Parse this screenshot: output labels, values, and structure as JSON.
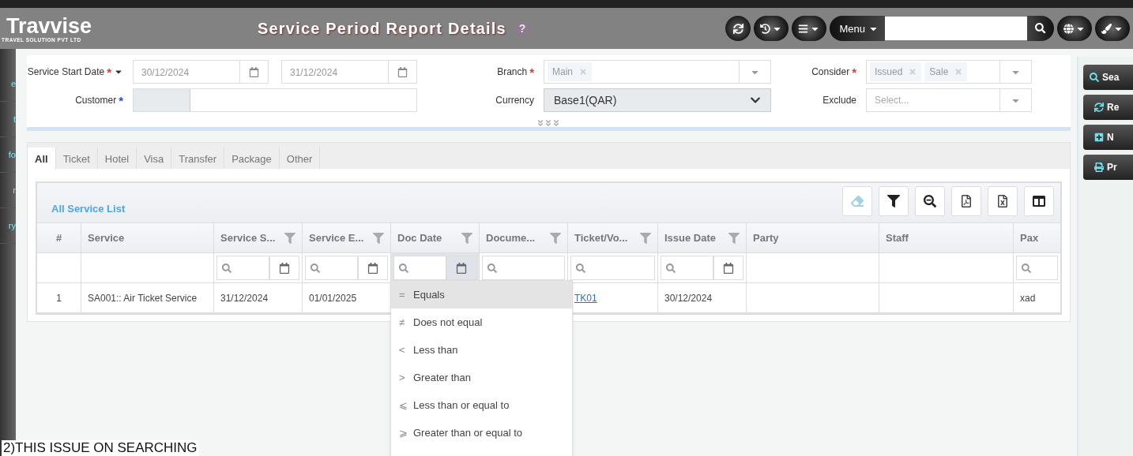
{
  "header": {
    "logo": "Travvise",
    "tagline": "TRAVEL SOLUTION PVT LTD",
    "title": "Service Period Report Details",
    "help": "?",
    "tools": [
      {
        "kind": "refresh",
        "caret": false
      },
      {
        "kind": "history",
        "caret": true
      },
      {
        "kind": "list",
        "caret": true
      }
    ],
    "menu_button": "Menu",
    "end_tools": [
      {
        "kind": "translate",
        "caret": true
      },
      {
        "kind": "brush",
        "caret": true
      }
    ]
  },
  "sidebar": {
    "items": [
      "e",
      "t",
      "fo",
      "r",
      "ry"
    ]
  },
  "filters": {
    "service_date": {
      "label": "Service Start Date",
      "mark": {
        "text": "*",
        "color": "#e53935"
      },
      "from": "30/12/2024",
      "to": "31/12/2024"
    },
    "customer": {
      "label": "Customer",
      "mark": {
        "text": "*",
        "color": "#1e4fd8"
      }
    },
    "branch": {
      "label": "Branch",
      "mark": {
        "text": "*",
        "color": "#e53935"
      },
      "tags": [
        "Main"
      ]
    },
    "currency": {
      "label": "Currency",
      "value": "Base1(QAR)"
    },
    "consider": {
      "label": "Consider",
      "mark": {
        "text": "*",
        "color": "#e53935"
      },
      "tags": [
        "Issued",
        "Sale"
      ]
    },
    "exclude": {
      "label": "Exclude",
      "placeholder": "Select..."
    }
  },
  "side_buttons": [
    {
      "kind": "search",
      "label": "Sea"
    },
    {
      "kind": "refresh",
      "label": "Re"
    },
    {
      "kind": "new",
      "label": "N"
    },
    {
      "kind": "print",
      "label": "Pr"
    }
  ],
  "tabs": [
    {
      "label": "All",
      "selected": true
    },
    {
      "label": "Ticket",
      "selected": false
    },
    {
      "label": "Hotel",
      "selected": false
    },
    {
      "label": "Visa",
      "selected": false
    },
    {
      "label": "Transfer",
      "selected": false
    },
    {
      "label": "Package",
      "selected": false
    },
    {
      "label": "Other",
      "selected": false
    }
  ],
  "grid": {
    "title": "All Service List",
    "tools": [
      {
        "kind": "eraser"
      },
      {
        "kind": "filter"
      },
      {
        "kind": "zoom-out"
      },
      {
        "kind": "pdf"
      },
      {
        "kind": "xlsx"
      },
      {
        "kind": "columns"
      }
    ],
    "columns": [
      {
        "label": "#",
        "funnel": false,
        "kind": "none",
        "menu_open": false
      },
      {
        "label": "Service",
        "funnel": false,
        "kind": "none",
        "menu_open": false
      },
      {
        "label": "Service S...",
        "funnel": true,
        "kind": "date",
        "menu_open": false
      },
      {
        "label": "Service E...",
        "funnel": true,
        "kind": "date",
        "menu_open": false
      },
      {
        "label": "Doc Date",
        "funnel": true,
        "kind": "date",
        "menu_open": true
      },
      {
        "label": "Docume...",
        "funnel": true,
        "kind": "text",
        "menu_open": false
      },
      {
        "label": "Ticket/Vo...",
        "funnel": true,
        "kind": "text",
        "menu_open": false
      },
      {
        "label": "Issue Date",
        "funnel": true,
        "kind": "date",
        "menu_open": false
      },
      {
        "label": "Party",
        "funnel": false,
        "kind": "none",
        "menu_open": false
      },
      {
        "label": "Staff",
        "funnel": false,
        "kind": "none",
        "menu_open": false
      },
      {
        "label": "Pax",
        "funnel": false,
        "kind": "text",
        "menu_open": false
      }
    ],
    "rows": [
      {
        "cells": [
          {
            "kind": "number",
            "text": "1"
          },
          {
            "kind": "text",
            "text": "SA001:: Air Ticket Service"
          },
          {
            "kind": "text",
            "text": "31/12/2024"
          },
          {
            "kind": "text",
            "text": "01/01/2025"
          },
          {
            "kind": "empty"
          },
          {
            "kind": "empty"
          },
          {
            "kind": "link",
            "text": "TK01"
          },
          {
            "kind": "text",
            "text": "30/12/2024"
          },
          {
            "kind": "empty"
          },
          {
            "kind": "empty"
          },
          {
            "kind": "text",
            "text": "xad"
          }
        ]
      }
    ]
  },
  "filter_menu": {
    "items": [
      {
        "symbol": "=",
        "label": "Equals",
        "selected": true
      },
      {
        "symbol": "≠",
        "label": "Does not equal",
        "selected": false
      },
      {
        "symbol": "<",
        "label": "Less than",
        "selected": false
      },
      {
        "symbol": ">",
        "label": "Greater than",
        "selected": false
      },
      {
        "symbol": "⩽",
        "label": "Less than or equal to",
        "selected": false
      },
      {
        "symbol": "⩾",
        "label": "Greater than or equal to",
        "selected": false
      }
    ]
  },
  "note": "2)THIS ISSUE ON SEARCHING"
}
